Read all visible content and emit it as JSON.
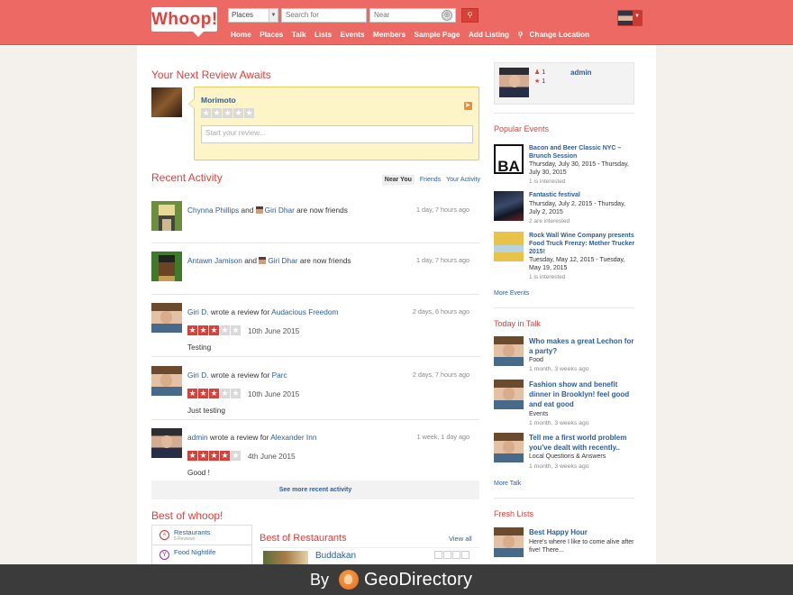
{
  "header": {
    "logo": "Whoop!",
    "search_type": "Places",
    "search_placeholder": "Search for",
    "near_placeholder": "Near",
    "nav": [
      "Home",
      "Places",
      "Talk",
      "Lists",
      "Events",
      "Members",
      "Sample Page",
      "Add Listing",
      "Change Location"
    ]
  },
  "next_review": {
    "heading": "Your Next Review Awaits",
    "place": "Morimoto",
    "placeholder": "Start your review..."
  },
  "activity": {
    "heading": "Recent Activity",
    "tabs": [
      "Near You",
      "Friends",
      "Your Activity"
    ],
    "items": [
      {
        "actor": "Chynna Phillips",
        "mid": "and",
        "target": "Giri Dhar",
        "tail": "are now friends",
        "time": "1 day, 7 hours ago"
      },
      {
        "actor": "Antawn Jamison",
        "mid": "and",
        "target": "Giri Dhar",
        "tail": "are now friends",
        "time": "1 day, 7 hours ago"
      },
      {
        "actor": "Giri D.",
        "mid": "wrote a review for",
        "target": "Audacious Freedom",
        "time": "2 days, 6 hours ago",
        "rating": 3,
        "date": "10th June 2015",
        "body": "Testing"
      },
      {
        "actor": "Giri D.",
        "mid": "wrote a review for",
        "target": "Parc",
        "time": "2 days, 7 hours ago",
        "rating": 3,
        "date": "10th June 2015",
        "body": "Just testing"
      },
      {
        "actor": "admin",
        "mid": "wrote a review for",
        "target": "Alexander Inn",
        "time": "1 week, 1 day ago",
        "rating": 4,
        "date": "4th June 2015",
        "body": "Good !"
      }
    ],
    "see_more": "See more recent activity"
  },
  "best_of": {
    "heading": "Best of whoop!",
    "categories": [
      {
        "name": "Restaurants",
        "sub": "5 Reviews"
      },
      {
        "name": "Food Nightlife",
        "sub": ""
      }
    ],
    "section_title": "Best of Restaurants",
    "view_all": "View all",
    "top_item": "Buddakan"
  },
  "sidebar": {
    "user": {
      "friends": "1",
      "reviews": "1",
      "name": "admin"
    },
    "events_heading": "Popular Events",
    "events": [
      {
        "title": "Bacon and Beer Classic NYC – Brunch Session",
        "date": "Thursday, July 30, 2015 - Thursday, July 30, 2015",
        "interested": "1 is interested"
      },
      {
        "title": "Fantastic festival",
        "date": "Thursday, July 2, 2015 - Thursday, July 2, 2015",
        "interested": "2 are interested"
      },
      {
        "title": "Rock Wall Wine Company presents Food Truck Frenzy: Mother Trucker 2015!",
        "date": "Tuesday, May 12, 2015 - Tuesday, May 19, 2015",
        "interested": "1 is interested"
      }
    ],
    "more_events": "More Events",
    "talk_heading": "Today in Talk",
    "talks": [
      {
        "title": "Who makes a great Lechon for a party?",
        "category": "Food",
        "time": "1 month, 3 weeks ago"
      },
      {
        "title": "Fashion show and benefit dinner in Brooklyn! feel good and eat good",
        "category": "Events",
        "time": "1 month, 3 weeks ago"
      },
      {
        "title": "Tell me a first world problem you've dealt with recently..",
        "category": "Local Questions & Answers",
        "time": "1 month, 3 weeks ago"
      }
    ],
    "more_talk": "More Talk",
    "lists_heading": "Fresh Lists",
    "list": {
      "title": "Best Happy Hour",
      "text": "Here's where I like to come alive after five! There..."
    }
  },
  "footer": {
    "by": "By",
    "brand": "GeoDirectory"
  },
  "colors": {
    "brand_red": "#ed6a64",
    "accent_red": "#e2403b",
    "link_blue": "#2a5d9f"
  }
}
